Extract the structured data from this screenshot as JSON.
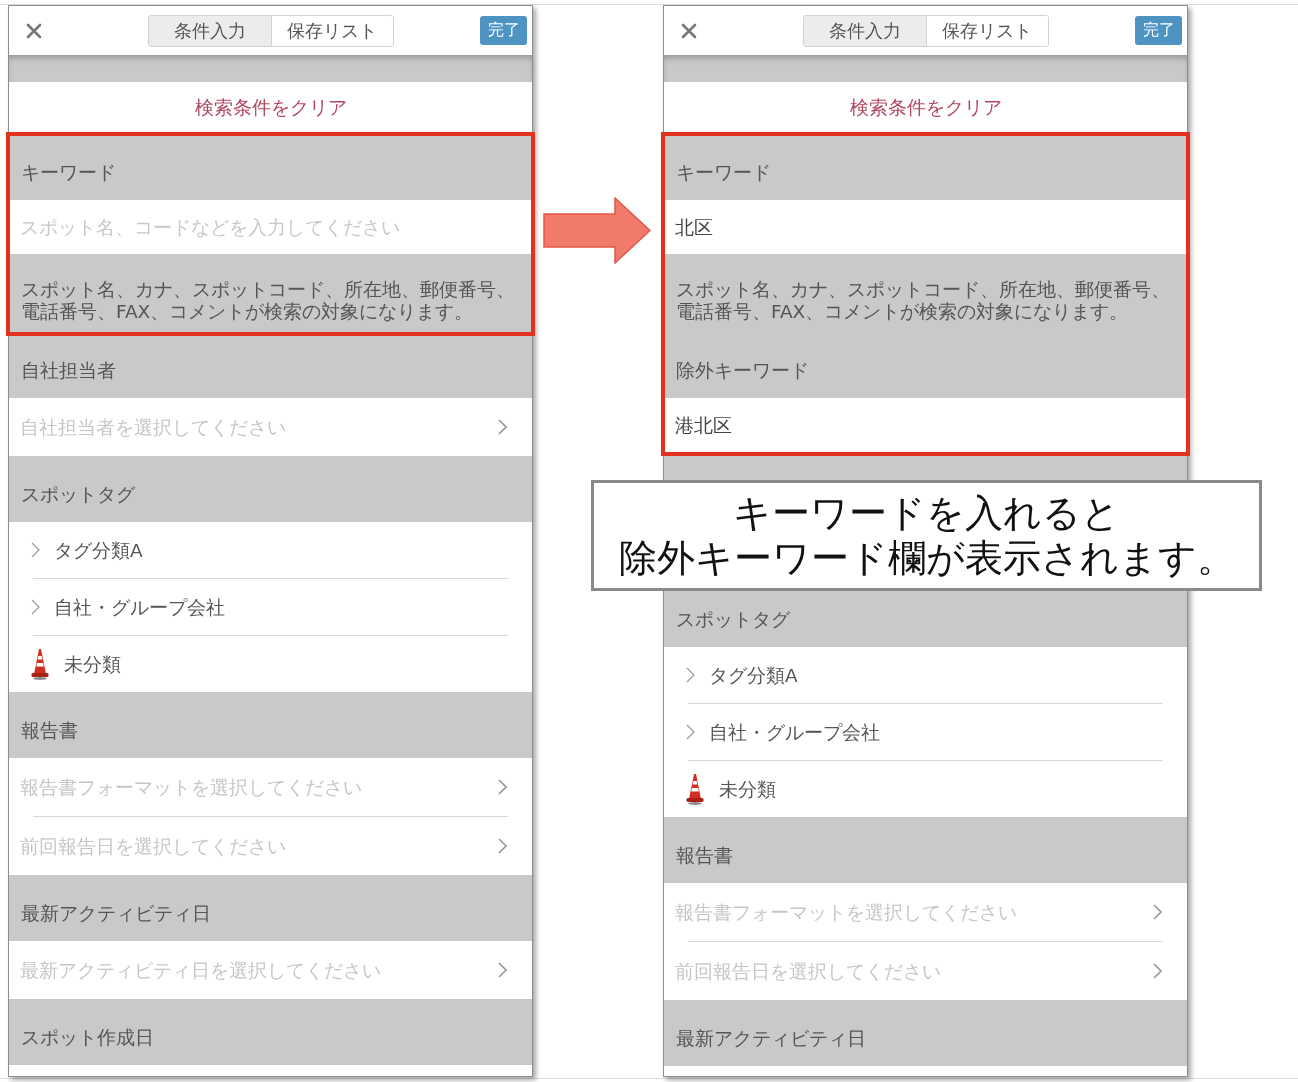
{
  "phones": [
    {
      "tabs": [
        {
          "label": "条件入力",
          "selected": true
        },
        {
          "label": "保存リスト",
          "selected": false
        }
      ],
      "done_button": "完了",
      "clear_link": "検索条件をクリア",
      "rows": [
        {
          "kind": "heading",
          "title": "キーワード",
          "highlighted": true
        },
        {
          "kind": "input",
          "placeholder": "スポット名、コードなどを入力してください",
          "highlighted": true
        },
        {
          "kind": "note",
          "text": "スポット名、カナ、スポットコード、所在地、郵便番号、電話番号、FAX、コメントが検索の対象になります。",
          "highlighted": true
        },
        {
          "kind": "heading",
          "title": "自社担当者",
          "highlighted": false
        },
        {
          "kind": "select",
          "placeholder": "自社担当者を選択してください",
          "highlighted": false
        },
        {
          "kind": "heading",
          "title": "スポットタグ",
          "highlighted": false
        },
        {
          "kind": "category",
          "label": "タグ分類A",
          "highlighted": false
        },
        {
          "kind": "category",
          "label": "自社・グループ会社",
          "highlighted": false
        },
        {
          "kind": "uncategorized",
          "label": "未分類",
          "highlighted": false
        },
        {
          "kind": "heading",
          "title": "報告書",
          "highlighted": false
        },
        {
          "kind": "select",
          "placeholder": "報告書フォーマットを選択してください",
          "highlighted": false
        },
        {
          "kind": "select",
          "placeholder": "前回報告日を選択してください",
          "highlighted": false
        },
        {
          "kind": "heading",
          "title": "最新アクティビティ日",
          "highlighted": false
        },
        {
          "kind": "select",
          "placeholder": "最新アクティビティ日を選択してください",
          "highlighted": false
        },
        {
          "kind": "heading",
          "title": "スポット作成日",
          "highlighted": false
        }
      ]
    },
    {
      "tabs": [
        {
          "label": "条件入力",
          "selected": true
        },
        {
          "label": "保存リスト",
          "selected": false
        }
      ],
      "done_button": "完了",
      "clear_link": "検索条件をクリア",
      "rows": [
        {
          "kind": "heading",
          "title": "キーワード",
          "highlighted": true
        },
        {
          "kind": "input",
          "value": "北区",
          "highlighted": true
        },
        {
          "kind": "note",
          "text": "スポット名、カナ、スポットコード、所在地、郵便番号、電話番号、FAX、コメントが検索の対象になります。",
          "highlighted": true
        },
        {
          "kind": "heading",
          "title": "除外キーワード",
          "highlighted": true
        },
        {
          "kind": "input",
          "value": "港北区",
          "highlighted": true
        },
        {
          "kind": "covered",
          "highlighted": false
        },
        {
          "kind": "heading",
          "title": "スポットタグ",
          "highlighted": false
        },
        {
          "kind": "category",
          "label": "タグ分類A",
          "highlighted": false
        },
        {
          "kind": "category",
          "label": "自社・グループ会社",
          "highlighted": false
        },
        {
          "kind": "uncategorized",
          "label": "未分類",
          "highlighted": false
        },
        {
          "kind": "heading",
          "title": "報告書",
          "highlighted": false
        },
        {
          "kind": "select",
          "placeholder": "報告書フォーマットを選択してください",
          "highlighted": false
        },
        {
          "kind": "select",
          "placeholder": "前回報告日を選択してください",
          "highlighted": false
        },
        {
          "kind": "heading",
          "title": "最新アクティビティ日",
          "highlighted": false
        }
      ]
    }
  ],
  "callout": {
    "lines": [
      "キーワードを入れると",
      "除外キーワード欄が表示されます。"
    ]
  }
}
